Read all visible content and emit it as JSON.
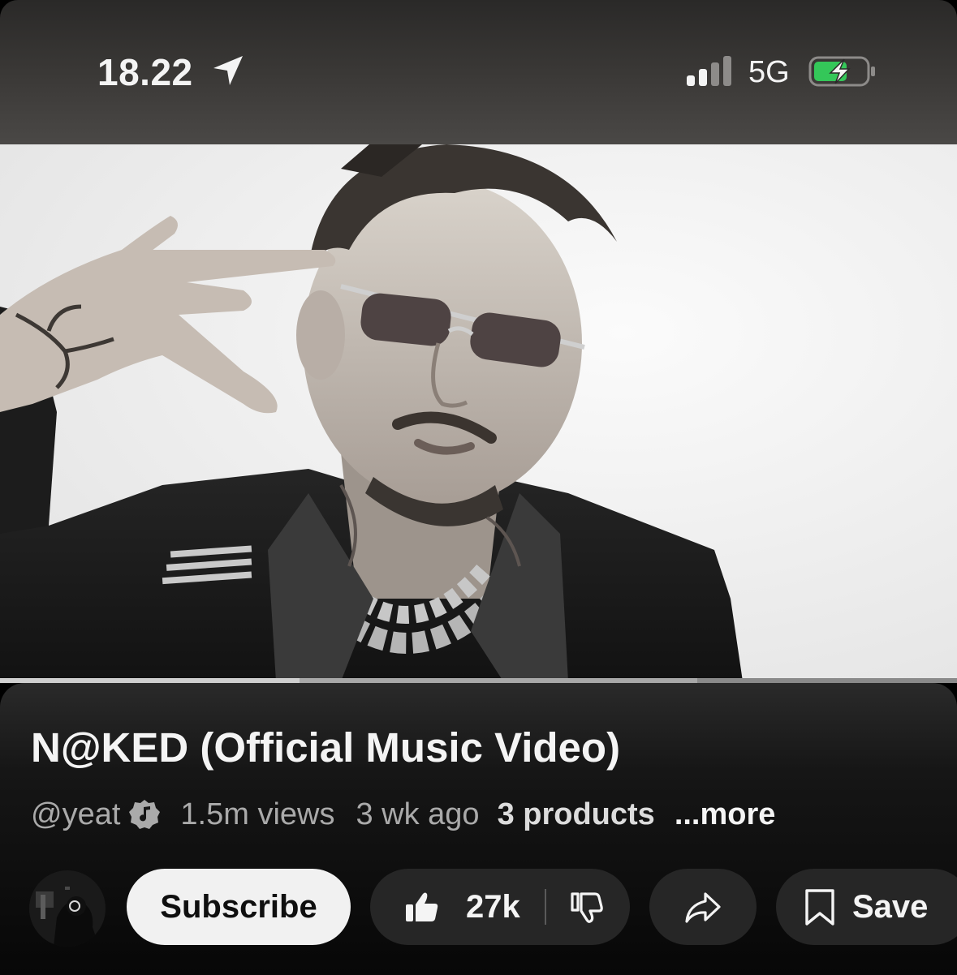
{
  "status_bar": {
    "time": "18.22",
    "network": "5G",
    "signal_bars_active": 2,
    "battery_charging": true,
    "icons": [
      "location-arrow-icon",
      "cellular-signal-icon",
      "battery-charging-icon"
    ]
  },
  "player": {
    "progress_fraction": 0.313,
    "buffered_fraction": 0.729
  },
  "video": {
    "title": "N@KED (Official Music Video)",
    "channel": "@yeat",
    "channel_badge": "verified-music-icon",
    "views": "1.5m views",
    "age": "3 wk ago",
    "products": "3 products",
    "more_label": "...more"
  },
  "actions": {
    "subscribe_label": "Subscribe",
    "like_count": "27k",
    "save_label": "Save",
    "icons": [
      "like-icon",
      "dislike-icon",
      "share-icon",
      "save-bookmark-icon"
    ]
  },
  "colors": {
    "background": "#000000",
    "pill": "#262626",
    "subscribe_bg": "#f1f1f1",
    "secondary_text": "#aaaaaa",
    "battery_green": "#34c759"
  }
}
